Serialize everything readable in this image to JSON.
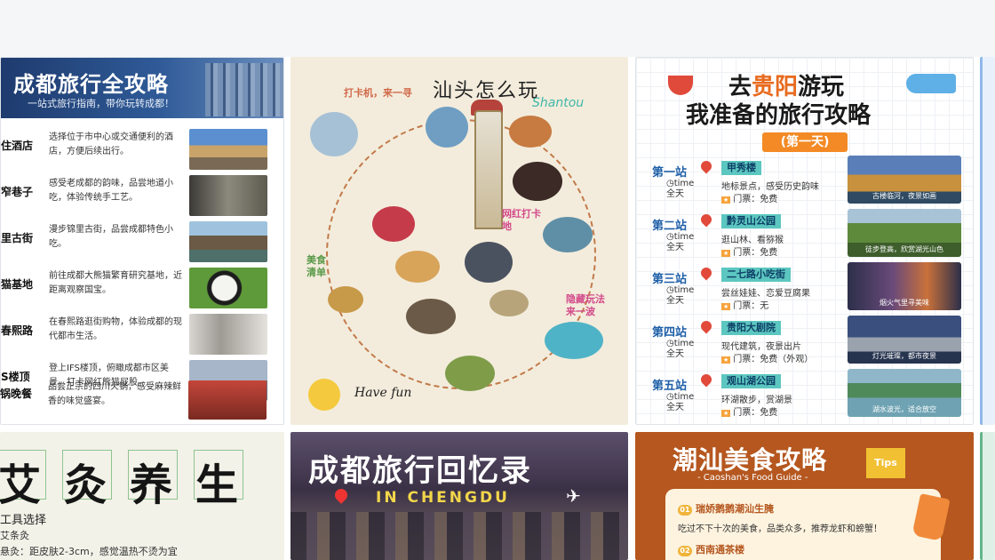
{
  "cards": {
    "chengdu": {
      "title": "成都旅行全攻略",
      "subtitle": "一站式旅行指南，带你玩转成都！",
      "items": [
        {
          "name": "住酒店",
          "desc": "选择位于市中心或交通便利的酒店，方便后续出行。"
        },
        {
          "name": "窄巷子",
          "desc": "感受老成都的韵味，品尝地道小吃，体验传统手工艺。"
        },
        {
          "name": "里古街",
          "desc": "漫步锦里古街，品尝成都特色小吃。"
        },
        {
          "name": "猫基地",
          "desc": "前往成都大熊猫繁育研究基地，近距离观察国宝。"
        },
        {
          "name": "春熙路",
          "desc": "在春熙路逛街购物，体验成都的现代都市生活。"
        },
        {
          "name": "S楼顶",
          "desc": "登上IFS楼顶，俯瞰成都市区美景，打卡网红熊猫屁股。"
        },
        {
          "name": "锅晚餐",
          "desc": "品尝正宗的四川火锅，感受麻辣鲜香的味觉盛宴。"
        }
      ]
    },
    "shantou": {
      "title": "汕头怎么玩",
      "subtitle": "Shantou",
      "tag1": "打卡机，来一寻",
      "tag2": "网红打卡地",
      "tag3": "美食清单",
      "tag4": "隐藏玩法来一波",
      "footer": "Have fun"
    },
    "guiyang": {
      "title_prefix": "去",
      "title_highlight": "贵阳",
      "title_suffix": "游玩",
      "title_line2": "我准备的旅行攻略",
      "day": "(第一天)",
      "stops": [
        {
          "label": "第一站",
          "place": "甲秀楼",
          "time": "time",
          "duration": "全天",
          "desc": "地标景点，感受历史韵味",
          "ticket": "门票：免费",
          "caption": "古楼临河，夜景如画"
        },
        {
          "label": "第二站",
          "place": "黔灵山公园",
          "time": "time",
          "duration": "全天",
          "desc": "逛山林、看猕猴",
          "ticket": "门票：免费",
          "caption": "徒步登高，欣赏湖光山色"
        },
        {
          "label": "第三站",
          "place": "二七路小吃街",
          "time": "time",
          "duration": "全天",
          "desc": "尝丝娃娃、恋爱豆腐果",
          "ticket": "门票：无",
          "caption": "烟火气里寻美味"
        },
        {
          "label": "第四站",
          "place": "贵阳大剧院",
          "time": "time",
          "duration": "全天",
          "desc": "现代建筑，夜景出片",
          "ticket": "门票：免费（外观）",
          "caption": "灯光璀璨，都市夜景"
        },
        {
          "label": "第五站",
          "place": "观山湖公园",
          "time": "time",
          "duration": "全天",
          "desc": "环湖散步，赏湖景",
          "ticket": "门票：免费",
          "caption": "湖水波光，适合放空"
        }
      ]
    },
    "moxibustion": {
      "chars": [
        "艾",
        "灸",
        "养",
        "生"
      ],
      "line1": "工具选择",
      "line2": "艾条灸",
      "line3": "悬灸：距皮肤2-3cm，感觉温热不烫为宜"
    },
    "chengdu_memory": {
      "title": "成都旅行回忆录",
      "subtitle": "IN CHENGDU"
    },
    "chaoshan": {
      "title": "潮汕美食攻略",
      "subtitle": "- Caoshan's Food Guide -",
      "tips": "Tips",
      "item1_no": "01",
      "item1_title": "瑞娇鹅鹅潮汕生腌",
      "item1_desc": "吃过不下十次的美食，品类众多，推荐龙虾和螃蟹！",
      "item2_no": "02",
      "item2_title": "西南通茶楼"
    }
  },
  "colors": {
    "chengdu_banner": "#1e3b6e",
    "guiyang_accent": "#e86b1f",
    "guiyang_station": "#1e5fa8",
    "chaoshan_bg": "#b5571f",
    "memory_yellow": "#f2d64a"
  }
}
